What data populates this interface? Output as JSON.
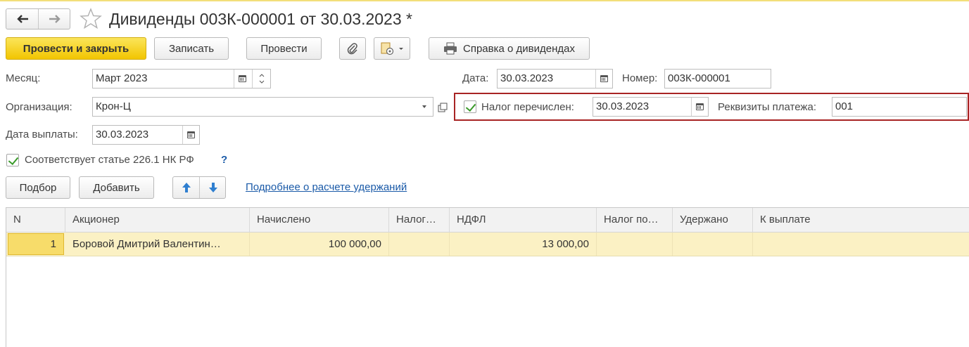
{
  "window": {
    "title": "Дивиденды 003К-000001 от 30.03.2023 *"
  },
  "toolbar": {
    "post_and_close": "Провести и закрыть",
    "save": "Записать",
    "post": "Провести",
    "dividend_report": "Справка о дивидендах"
  },
  "form": {
    "month_label": "Месяц:",
    "month_value": "Март 2023",
    "date_label": "Дата:",
    "date_value": "30.03.2023",
    "number_label": "Номер:",
    "number_value": "003К-000001",
    "org_label": "Организация:",
    "org_value": "Крон-Ц",
    "tax_paid_label": "Налог перечислен:",
    "tax_paid_date": "30.03.2023",
    "payment_details_label": "Реквизиты платежа:",
    "payment_details_value": "001",
    "payout_date_label": "Дата выплаты:",
    "payout_date_value": "30.03.2023",
    "article_label": "Соответствует статье 226.1 НК РФ",
    "help": "?"
  },
  "actions": {
    "select": "Подбор",
    "add": "Добавить",
    "details_link": "Подробнее о расчете удержаний"
  },
  "table": {
    "columns": [
      "N",
      "Акционер",
      "Начислено",
      "Налог…",
      "НДФЛ",
      "Налог по…",
      "Удержано",
      "К выплате"
    ],
    "rows": [
      {
        "n": "1",
        "shareholder": "Боровой Дмитрий Валентин…",
        "accrued": "100 000,00",
        "tax": "",
        "ndfl": "13 000,00",
        "tax_by": "",
        "withheld": "",
        "to_pay": ""
      }
    ]
  },
  "colors": {
    "primary_button": "#f5cf1a",
    "highlight_border": "#a82424",
    "selected_row": "#fbf1c4",
    "check_green": "#3a9a2a",
    "link": "#1a5aa8"
  }
}
